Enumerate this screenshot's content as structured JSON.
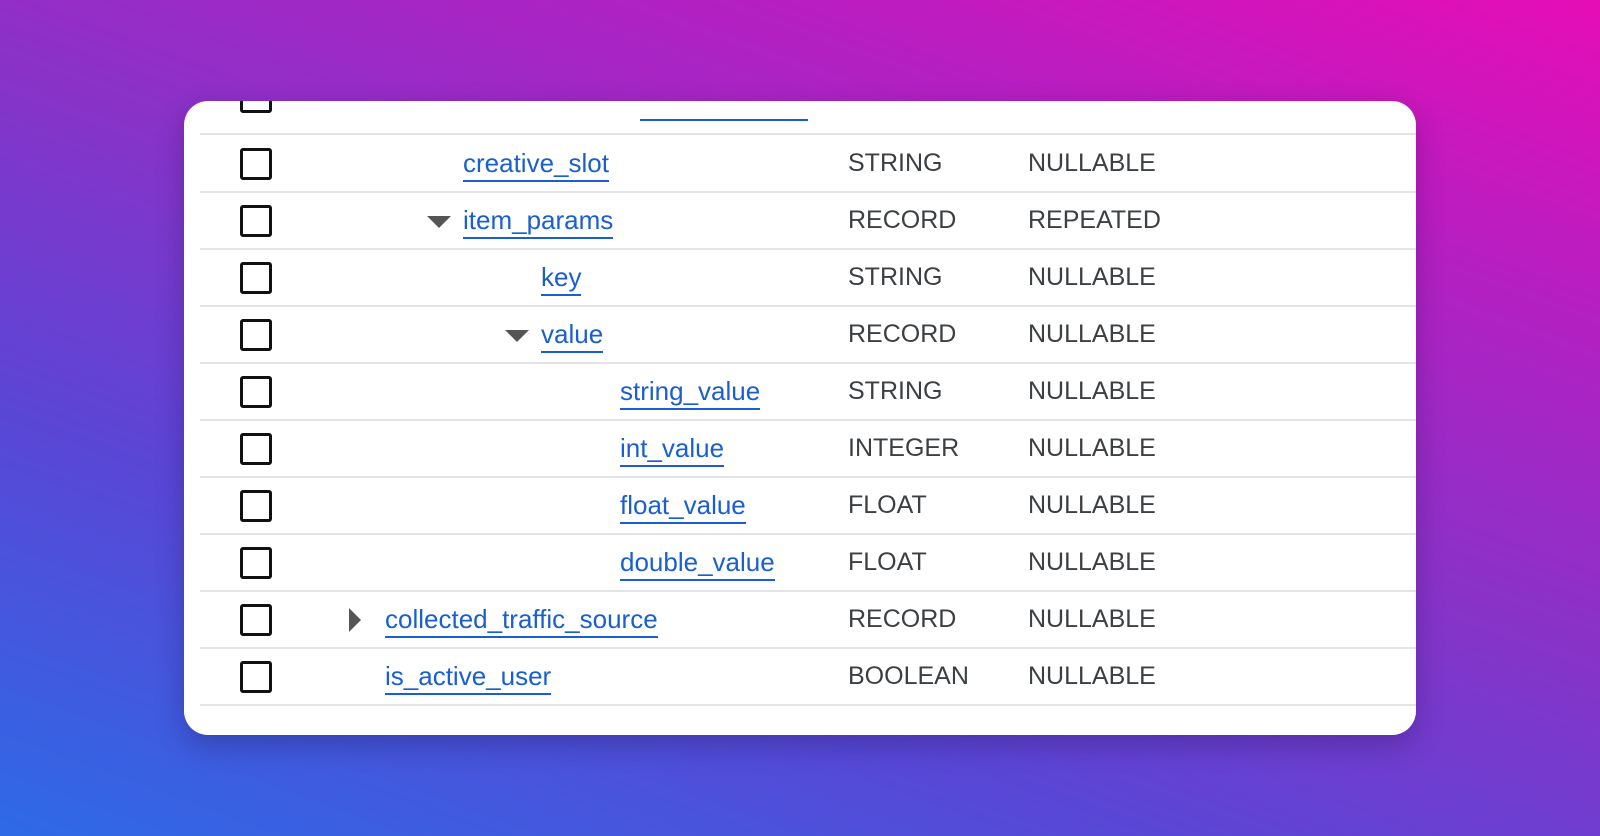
{
  "schema": {
    "rows": [
      {
        "name": "creative_slot",
        "type": "STRING",
        "mode": "NULLABLE",
        "depth": 2,
        "caret": "none"
      },
      {
        "name": "item_params",
        "type": "RECORD",
        "mode": "REPEATED",
        "depth": 2,
        "caret": "down"
      },
      {
        "name": "key",
        "type": "STRING",
        "mode": "NULLABLE",
        "depth": 3,
        "caret": "none"
      },
      {
        "name": "value",
        "type": "RECORD",
        "mode": "NULLABLE",
        "depth": 3,
        "caret": "down"
      },
      {
        "name": "string_value",
        "type": "STRING",
        "mode": "NULLABLE",
        "depth": 4,
        "caret": "none"
      },
      {
        "name": "int_value",
        "type": "INTEGER",
        "mode": "NULLABLE",
        "depth": 4,
        "caret": "none"
      },
      {
        "name": "float_value",
        "type": "FLOAT",
        "mode": "NULLABLE",
        "depth": 4,
        "caret": "none"
      },
      {
        "name": "double_value",
        "type": "FLOAT",
        "mode": "NULLABLE",
        "depth": 4,
        "caret": "none"
      },
      {
        "name": "collected_traffic_source",
        "type": "RECORD",
        "mode": "NULLABLE",
        "depth": 1,
        "caret": "right"
      },
      {
        "name": "is_active_user",
        "type": "BOOLEAN",
        "mode": "NULLABLE",
        "depth": 1,
        "caret": "none"
      }
    ]
  },
  "icons": {
    "checkbox": "checkbox-unchecked-icon",
    "expanded": "caret-down-icon",
    "collapsed": "caret-right-icon"
  },
  "colors": {
    "link": "#1a5fd0",
    "text": "#3c4043",
    "divider": "#e2e4e7",
    "gradient_start": "#2d6ae6",
    "gradient_end": "#e60db6"
  }
}
